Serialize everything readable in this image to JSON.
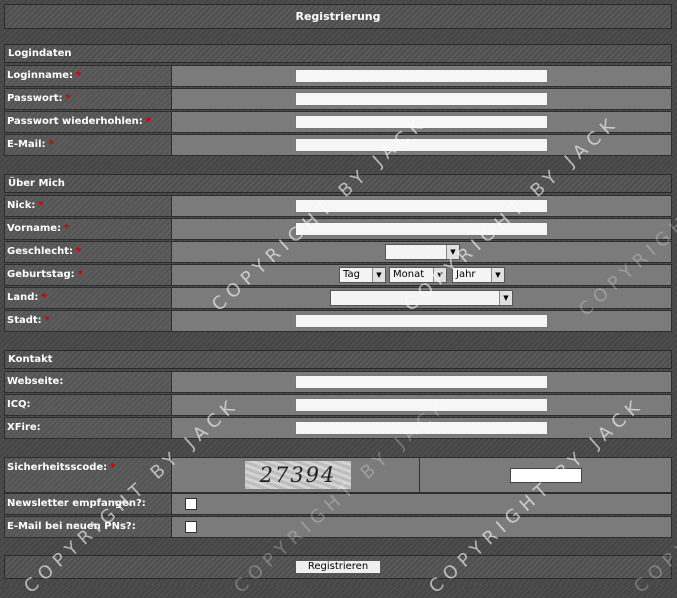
{
  "header": {
    "title": "Registrierung"
  },
  "sections": {
    "login": {
      "title": "Logindaten",
      "loginname": "Loginname:",
      "passwort": "Passwort:",
      "passwort_wdh": "Passwort wiederhohlen:",
      "email": "E-Mail:"
    },
    "about": {
      "title": "Über Mich",
      "nick": "Nick:",
      "vorname": "Vorname:",
      "geschlecht": "Geschlecht:",
      "geburtstag": "Geburtstag:",
      "tag": "Tag",
      "monat": "Monat",
      "jahr": "Jahr",
      "land": "Land:",
      "stadt": "Stadt:"
    },
    "contact": {
      "title": "Kontakt",
      "webseite": "Webseite:",
      "icq": "ICQ:",
      "xfire": "XFire:"
    },
    "security": {
      "code_label": "Sicherheitsscode:",
      "captcha_text": "27394",
      "newsletter": "Newsletter empfangen?:",
      "email_pn": "E-Mail bei neuen PNs?:"
    }
  },
  "required_mark": "*",
  "submit": {
    "label": "Registrieren"
  },
  "watermark": "COPYRIGHT BY JACK"
}
